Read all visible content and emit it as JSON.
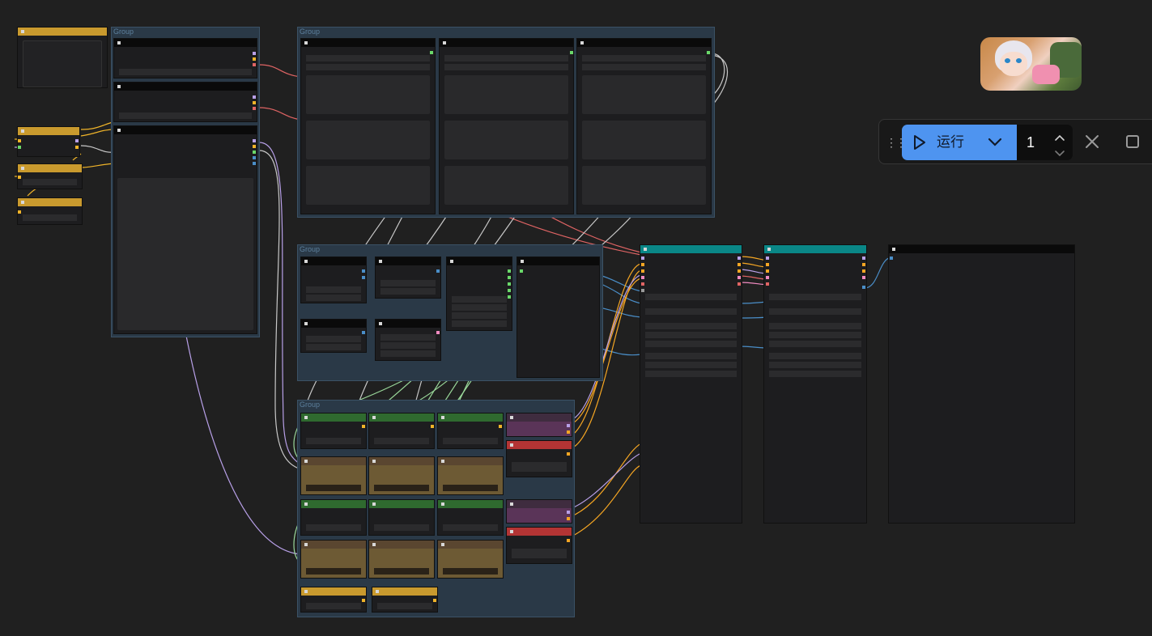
{
  "canvas": {
    "groups": [
      {
        "title": "Group"
      },
      {
        "title": "Group"
      },
      {
        "title": "Group"
      },
      {
        "title": "Group"
      }
    ]
  },
  "toolbar": {
    "run_label": "运行",
    "batch_count": "1",
    "icons": [
      "drag-handle-icon",
      "play-icon",
      "chevron-down-icon",
      "chevron-up-icon",
      "chevron-down-icon",
      "close-icon",
      "stop-icon"
    ]
  },
  "colors": {
    "canvas_bg": "#202020",
    "group_bg": "#2a3947",
    "node_bg": "#1d1d1f",
    "run_button": "#4e94f0",
    "wire_yellow": "#f0b429",
    "wire_red": "#e06464",
    "wire_purple": "#b8a0e8",
    "wire_green": "#9ad89a",
    "wire_blue": "#4a8ec8",
    "wire_grey": "#c8c8c8",
    "wire_orange": "#f5a623"
  }
}
